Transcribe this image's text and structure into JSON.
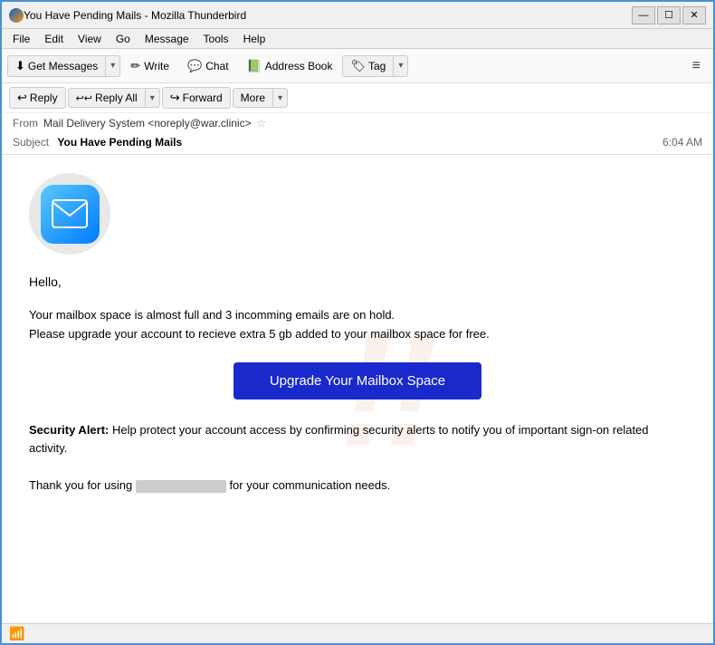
{
  "window": {
    "title": "You Have Pending Mails - Mozilla Thunderbird",
    "controls": {
      "minimize": "—",
      "maximize": "☐",
      "close": "✕"
    }
  },
  "menubar": {
    "items": [
      "File",
      "Edit",
      "View",
      "Go",
      "Message",
      "Tools",
      "Help"
    ]
  },
  "toolbar": {
    "get_messages": "Get Messages",
    "write": "Write",
    "chat": "Chat",
    "address_book": "Address Book",
    "tag": "Tag",
    "hamburger": "≡"
  },
  "email_actions": {
    "reply": "Reply",
    "reply_all": "Reply All",
    "forward": "Forward",
    "more": "More"
  },
  "email_meta": {
    "from_label": "From",
    "from_name": "Mail Delivery System <noreply@war.clinic>",
    "subject_label": "Subject",
    "subject": "You Have Pending Mails",
    "time": "6:04 AM"
  },
  "email_body": {
    "greeting": "Hello,",
    "paragraph1": "Your mailbox space is almost full and 3 incomming emails are on hold.\nPlease upgrade your account to recieve extra 5 gb added to your mailbox space for free.",
    "upgrade_button": "Upgrade Your Mailbox Space",
    "security_heading": "Security Alert:",
    "security_text": " Help protect your account access by confirming security alerts to notify you of important sign-on related activity.",
    "thank_you": "Thank you for using",
    "thank_you_end": "for your communication needs."
  },
  "status_bar": {
    "icon": "wifi-icon"
  }
}
